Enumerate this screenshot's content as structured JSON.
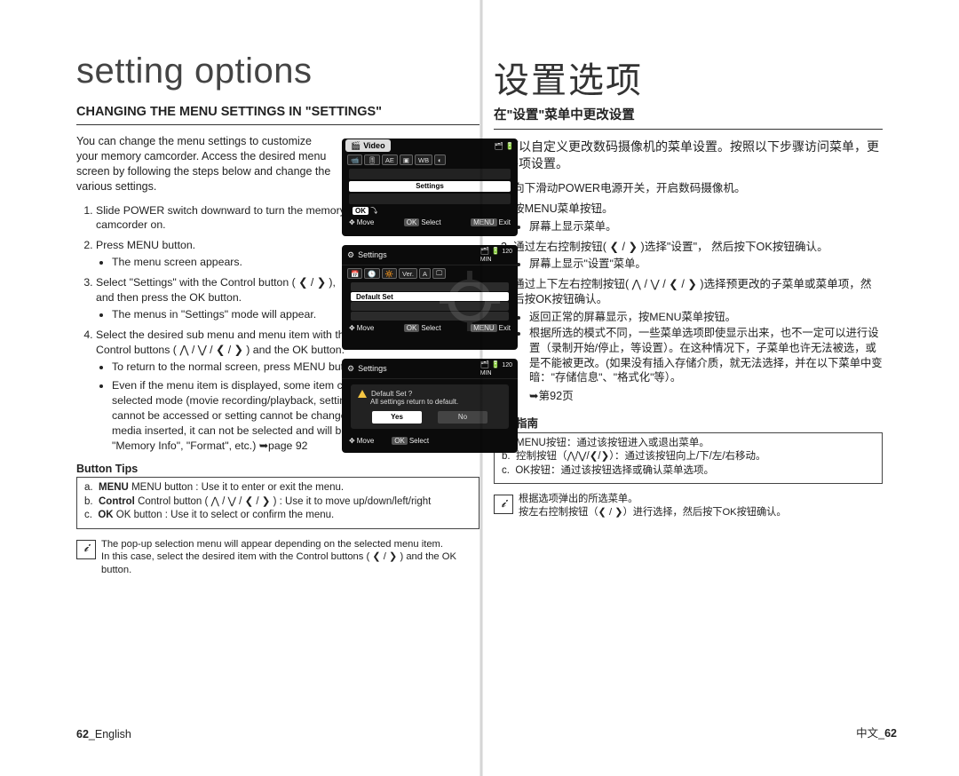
{
  "title": {
    "en": "setting options",
    "zh": "设置选项"
  },
  "left": {
    "header": "CHANGING THE MENU SETTINGS IN \"SETTINGS\"",
    "intro": "You can change the menu settings to customize your memory camcorder.  Access the desired menu screen by following the steps below and change the various settings.",
    "steps": {
      "s1": "Slide POWER switch downward to turn the memory camcorder on.",
      "s2": "Press MENU button.",
      "s2a": "The menu screen appears.",
      "s3_a": "Select \"Settings\" with the Control button ( ❮ / ❯ ),",
      "s3_b": "and then press the OK button.",
      "s3a": "The menus in \"Settings\" mode will appear.",
      "s4_a": "Select the desired sub menu and menu item with the Control buttons ( ⋀ / ⋁ / ❮ / ❯ ) and the OK button.",
      "s4b1": "To return to the normal screen, press MENU button.",
      "s4b2": "Even if the menu item is displayed, some item cannot be set depending on the selected mode (movie recording/playback, settings). In this case, sub menu cannot be accessed or setting cannot be changed. (If there is no storage media inserted, it can not be selected and will be dimmed on the menu: \"Memory Info\", \"Format\", etc.) ➥page 92"
    },
    "tips_hdr": "Button Tips",
    "tips": {
      "a": "MENU button : Use it to enter or exit the menu.",
      "b": "Control button ( ⋀ / ⋁ / ❮ / ❯ ) : Use it to move up/down/left/right",
      "c": "OK button : Use it to select or confirm the menu."
    },
    "note": {
      "l1": "The pop-up selection menu will appear depending on the selected menu item.",
      "l2": "In this case, select the desired item with the Control buttons ( ❮ / ❯ ) and the OK button."
    }
  },
  "right": {
    "header": "在\"设置\"菜单中更改设置",
    "intro": "您可以自定义更改数码摄像机的菜单设置。按照以下步骤访问菜单，更改各项设置。",
    "steps": {
      "s1": "向下滑动POWER电源开关，开启数码摄像机。",
      "s2": "按MENU菜单按钮。",
      "s2a": "屏幕上显示菜单。",
      "s3_a": "通过左右控制按钮( ❮ / ❯ )选择\"设置\"，",
      "s3_b": "然后按下OK按钮确认。",
      "s3a": "屏幕上显示\"设置\"菜单。",
      "s4_a": "通过上下左右控制按钮( ⋀ / ⋁ / ❮ / ❯ )选择预更改的子菜单或菜单项，然后按OK按钮确认。",
      "s4b1": "返回正常的屏幕显示，按MENU菜单按钮。",
      "s4b2": "根据所选的模式不同，一些菜单选项即使显示出来，也不一定可以进行设置（录制开始/停止，等设置）。在这种情况下，子菜单也许无法被选，或是不能被更改。(如果没有插入存储介质，就无法选择，并在以下菜单中变暗：\"存储信息\"、\"格式化\"等）。",
      "s4b3": "➥第92页"
    },
    "tips_hdr": "按钮指南",
    "tips": {
      "a": "MENU按钮：通过该按钮进入或退出菜单。",
      "b": "控制按钮（⋀/⋁/❮/❯）：通过该按钮向上/下/左/右移动。",
      "c": "OK按钮：通过该按钮选择或确认菜单选项。"
    },
    "note": {
      "l1": "根据选项弹出的所选菜单。",
      "l2": "按左右控制按钮（❮ / ❯）进行选择，然后按下OK按钮确认。"
    }
  },
  "lcd": {
    "s1": {
      "pill": "Video",
      "settings": "Settings",
      "ok": "OK",
      "move": "Move",
      "select": "Select",
      "menu": "MENU",
      "exit": "Exit"
    },
    "s2": {
      "title": "Settings",
      "defaultset": "Default Set",
      "ver": "Ver.",
      "a": "A",
      "move": "Move",
      "select": "Select",
      "menu": "MENU",
      "exit": "Exit",
      "ok": "OK"
    },
    "s3": {
      "title": "Settings",
      "q": "Default Set ?",
      "sub": "All settings return to default.",
      "yes": "Yes",
      "no": "No",
      "move": "Move",
      "select": "Select",
      "ok": "OK"
    }
  },
  "pg": {
    "left_num": "62",
    "left_lang": "English",
    "right_lang": "中文",
    "right_num": "62"
  }
}
